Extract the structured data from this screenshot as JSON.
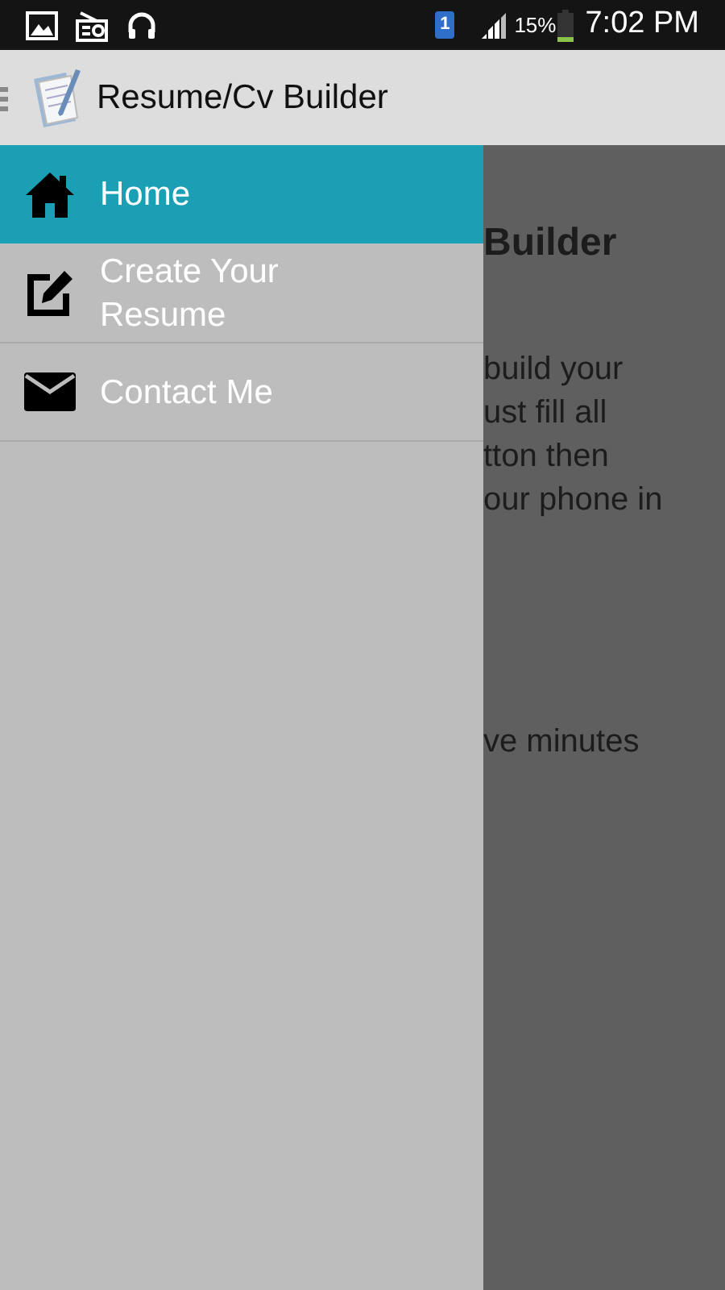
{
  "status_bar": {
    "sim_badge": "1",
    "battery": "15%",
    "time": "7:02 PM"
  },
  "app_bar": {
    "title": "Resume/Cv Builder"
  },
  "drawer": {
    "items": [
      {
        "kind": "home",
        "label": "Home",
        "selected": true
      },
      {
        "kind": "edit",
        "label": "Create Your Resume",
        "selected": false
      },
      {
        "kind": "mail",
        "label": "Contact Me",
        "selected": false
      }
    ]
  },
  "background_content": {
    "heading": "Builder",
    "lines": [
      "build your",
      "ust fill all",
      "tton then",
      "our phone in"
    ],
    "last_line": "ve minutes"
  }
}
